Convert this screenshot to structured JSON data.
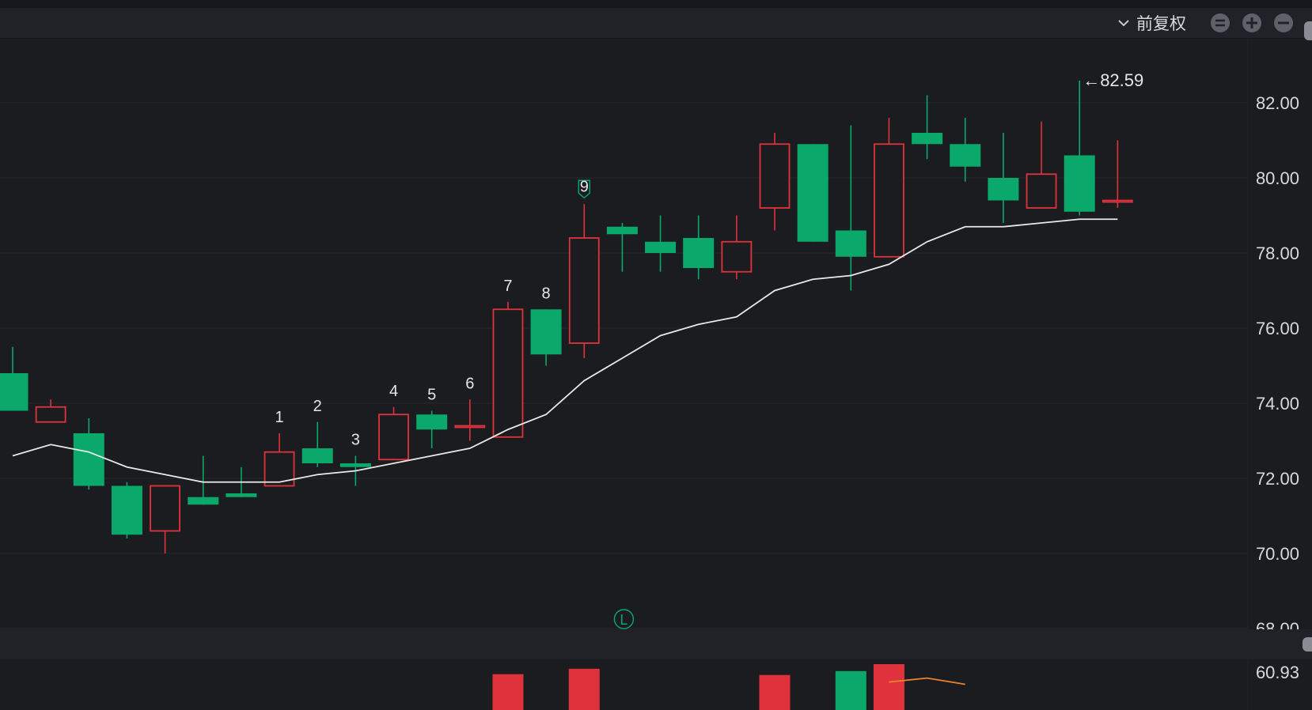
{
  "toolbar": {
    "adjust_label": "前复权",
    "buttons": [
      "reset-icon",
      "zoom-in-icon",
      "zoom-out-icon"
    ]
  },
  "colors": {
    "up": "#e0323c",
    "down": "#0aa86a",
    "ma": "#e9e9e9",
    "grid": "#26282c",
    "axis_text": "#d9d9d9",
    "vol_line": "#e8842a"
  },
  "chart_data": {
    "type": "candlestick",
    "price_axis": {
      "ticks": [
        "82.00",
        "80.00",
        "78.00",
        "76.00",
        "74.00",
        "72.00",
        "70.00",
        "68.00"
      ],
      "range": [
        67.6,
        83.5
      ]
    },
    "candles": [
      {
        "o": 74.8,
        "c": 73.8,
        "h": 75.5,
        "l": 73.8
      },
      {
        "o": 73.5,
        "c": 73.9,
        "h": 74.1,
        "l": 73.5
      },
      {
        "o": 73.2,
        "c": 71.8,
        "h": 73.6,
        "l": 71.7
      },
      {
        "o": 71.8,
        "c": 70.5,
        "h": 71.9,
        "l": 70.4
      },
      {
        "o": 70.6,
        "c": 71.8,
        "h": 71.8,
        "l": 70.0
      },
      {
        "o": 71.5,
        "c": 71.3,
        "h": 72.6,
        "l": 71.3
      },
      {
        "o": 71.6,
        "c": 71.5,
        "h": 72.3,
        "l": 71.5
      },
      {
        "o": 71.8,
        "c": 72.7,
        "h": 73.2,
        "l": 71.8
      },
      {
        "o": 72.8,
        "c": 72.4,
        "h": 73.5,
        "l": 72.3
      },
      {
        "o": 72.4,
        "c": 72.3,
        "h": 72.6,
        "l": 71.8
      },
      {
        "o": 72.5,
        "c": 73.7,
        "h": 73.9,
        "l": 72.5
      },
      {
        "o": 73.7,
        "c": 73.3,
        "h": 73.8,
        "l": 72.8
      },
      {
        "o": 73.4,
        "c": 73.4,
        "h": 74.1,
        "l": 73.0
      },
      {
        "o": 73.1,
        "c": 76.5,
        "h": 76.7,
        "l": 73.1
      },
      {
        "o": 76.5,
        "c": 75.3,
        "h": 76.5,
        "l": 75.0
      },
      {
        "o": 75.6,
        "c": 78.4,
        "h": 79.3,
        "l": 75.2
      },
      {
        "o": 78.7,
        "c": 78.5,
        "h": 78.8,
        "l": 77.5
      },
      {
        "o": 78.3,
        "c": 78.0,
        "h": 79.0,
        "l": 77.5
      },
      {
        "o": 78.4,
        "c": 77.6,
        "h": 79.0,
        "l": 77.3
      },
      {
        "o": 77.5,
        "c": 78.3,
        "h": 79.0,
        "l": 77.3
      },
      {
        "o": 79.2,
        "c": 80.9,
        "h": 81.2,
        "l": 78.6
      },
      {
        "o": 80.9,
        "c": 78.3,
        "h": 80.9,
        "l": 78.3
      },
      {
        "o": 78.6,
        "c": 77.9,
        "h": 81.4,
        "l": 77.0
      },
      {
        "o": 77.9,
        "c": 80.9,
        "h": 81.6,
        "l": 77.9
      },
      {
        "o": 81.2,
        "c": 80.9,
        "h": 82.2,
        "l": 80.5
      },
      {
        "o": 80.9,
        "c": 80.3,
        "h": 81.6,
        "l": 79.9
      },
      {
        "o": 80.0,
        "c": 79.4,
        "h": 81.2,
        "l": 78.8
      },
      {
        "o": 79.2,
        "c": 80.1,
        "h": 81.5,
        "l": 79.2
      },
      {
        "o": 80.6,
        "c": 79.1,
        "h": 82.59,
        "l": 79.0
      },
      {
        "o": 79.4,
        "c": 79.4,
        "h": 81.0,
        "l": 79.2
      }
    ],
    "ma_line": [
      72.6,
      72.9,
      72.7,
      72.3,
      72.1,
      71.9,
      71.9,
      71.9,
      72.1,
      72.2,
      72.4,
      72.6,
      72.8,
      73.3,
      73.7,
      74.6,
      75.2,
      75.8,
      76.1,
      76.3,
      77.0,
      77.3,
      77.4,
      77.7,
      78.3,
      78.7,
      78.7,
      78.8,
      78.9,
      78.9
    ],
    "sequence_labels": [
      {
        "index": 7,
        "text": "1"
      },
      {
        "index": 8,
        "text": "2"
      },
      {
        "index": 9,
        "text": "3"
      },
      {
        "index": 10,
        "text": "4"
      },
      {
        "index": 11,
        "text": "5"
      },
      {
        "index": 12,
        "text": "6"
      },
      {
        "index": 13,
        "text": "7"
      },
      {
        "index": 14,
        "text": "8"
      },
      {
        "index": 15,
        "text": "9"
      }
    ],
    "max_label": {
      "index": 28,
      "value": 82.59,
      "text": "←82.59"
    },
    "marker": {
      "index": 16,
      "text": "L"
    },
    "volume": {
      "axis_label": "60.93",
      "bars": [
        {
          "index": 13,
          "value": 48,
          "dir": "up"
        },
        {
          "index": 15,
          "value": 55,
          "dir": "up"
        },
        {
          "index": 20,
          "value": 47,
          "dir": "up"
        },
        {
          "index": 22,
          "value": 52,
          "dir": "down"
        },
        {
          "index": 23,
          "value": 60.93,
          "dir": "up"
        }
      ],
      "line": [
        {
          "index": 23,
          "value": 38
        },
        {
          "index": 24,
          "value": 43
        },
        {
          "index": 25,
          "value": 35
        }
      ]
    }
  }
}
